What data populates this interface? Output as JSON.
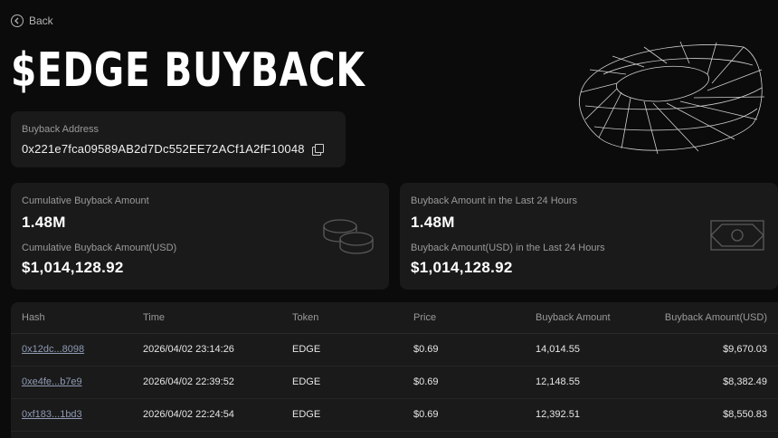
{
  "nav": {
    "back_label": "Back"
  },
  "page": {
    "title": "$EDGE BUYBACK"
  },
  "address": {
    "label": "Buyback Address",
    "value": "0x221e7fca09589AB2d7Dc552EE72ACf1A2fF10048"
  },
  "cumulative": {
    "amount_label": "Cumulative Buyback Amount",
    "amount": "1.48M",
    "usd_label": "Cumulative Buyback Amount(USD)",
    "usd": "$1,014,128.92"
  },
  "last24": {
    "amount_label": "Buyback Amount in the Last 24 Hours",
    "amount": "1.48M",
    "usd_label": "Buyback Amount(USD) in the Last 24 Hours",
    "usd": "$1,014,128.92"
  },
  "table": {
    "headers": [
      "Hash",
      "Time",
      "Token",
      "Price",
      "Buyback Amount",
      "Buyback Amount(USD)"
    ],
    "rows": [
      {
        "hash": "0x12dc...8098",
        "time": "2026/04/02 23:14:26",
        "token": "EDGE",
        "price": "$0.69",
        "amount": "14,014.55",
        "usd": "$9,670.03"
      },
      {
        "hash": "0xe4fe...b7e9",
        "time": "2026/04/02 22:39:52",
        "token": "EDGE",
        "price": "$0.69",
        "amount": "12,148.55",
        "usd": "$8,382.49"
      },
      {
        "hash": "0xf183...1bd3",
        "time": "2026/04/02 22:24:54",
        "token": "EDGE",
        "price": "$0.69",
        "amount": "12,392.51",
        "usd": "$8,550.83"
      }
    ]
  },
  "icons": {
    "back": "back-arrow-icon",
    "copy": "copy-icon",
    "coins": "coins-icon",
    "banknote": "banknote-icon",
    "hero": "wireframe-torus-icon"
  }
}
